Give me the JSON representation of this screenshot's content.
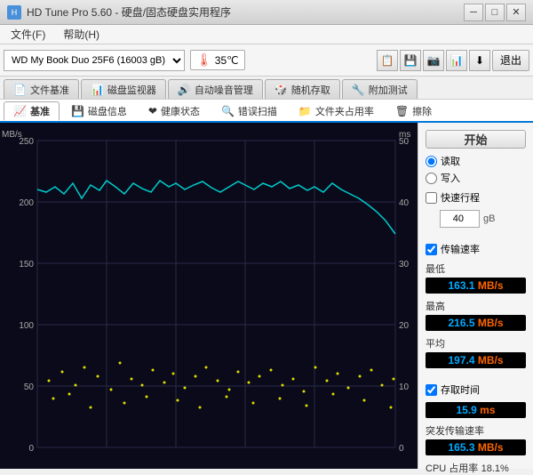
{
  "titleBar": {
    "title": "HD Tune Pro 5.60 - 硬盘/固态硬盘实用程序",
    "minimizeBtn": "─",
    "maximizeBtn": "□",
    "closeBtn": "✕"
  },
  "menuBar": {
    "items": [
      {
        "label": "文件(F)"
      },
      {
        "label": "帮助(H)"
      }
    ]
  },
  "toolbar": {
    "deviceName": "WD     My Book Duo 25F6 (16003 gB)",
    "temperature": "35℃",
    "exitBtn": "退出"
  },
  "tabs": {
    "row1": [
      {
        "label": "文件基准",
        "icon": "📄",
        "active": false
      },
      {
        "label": "磁盘监视器",
        "icon": "📊",
        "active": false
      },
      {
        "label": "自动噪音管理",
        "icon": "🔊",
        "active": false
      },
      {
        "label": "随机存取",
        "icon": "🎲",
        "active": false
      },
      {
        "label": "附加测试",
        "icon": "🔧",
        "active": false
      }
    ],
    "row2": [
      {
        "label": "基准",
        "icon": "📈",
        "active": true
      },
      {
        "label": "磁盘信息",
        "icon": "💾",
        "active": false
      },
      {
        "label": "健康状态",
        "icon": "❤",
        "active": false
      },
      {
        "label": "错误扫描",
        "icon": "🔍",
        "active": false
      },
      {
        "label": "文件夹占用率",
        "icon": "📁",
        "active": false
      },
      {
        "label": "擦除",
        "icon": "🗑",
        "active": false
      }
    ]
  },
  "chart": {
    "yAxisLeft": {
      "unit": "MB/s",
      "labels": [
        "250",
        "200",
        "150",
        "100",
        "50",
        "0"
      ]
    },
    "yAxisRight": {
      "unit": "ms",
      "labels": [
        "50",
        "40",
        "30",
        "20",
        "10",
        "0"
      ]
    }
  },
  "sidebar": {
    "startBtn": "开始",
    "readLabel": "读取",
    "writeLabel": "写入",
    "quickTestLabel": "快速行程",
    "quickTestValue": "40",
    "quickTestUnit": "gB",
    "transferRateLabel": "传输速率",
    "minLabel": "最低",
    "minValue": "163.1",
    "minUnit": "MB/s",
    "maxLabel": "最高",
    "maxValue": "216.5",
    "maxUnit": "MB/s",
    "avgLabel": "平均",
    "avgValue": "197.4",
    "avgUnit": "MB/s",
    "accessTimeLabel": "存取时间",
    "accessTimeValue": "15.9",
    "accessTimeUnit": "ms",
    "burstRateLabel": "突发传输速率",
    "burstRateValue": "165.3",
    "burstRateUnit": "MB/s",
    "cpuLabel": "CPU 占用率",
    "cpuValue": "18.1%"
  }
}
